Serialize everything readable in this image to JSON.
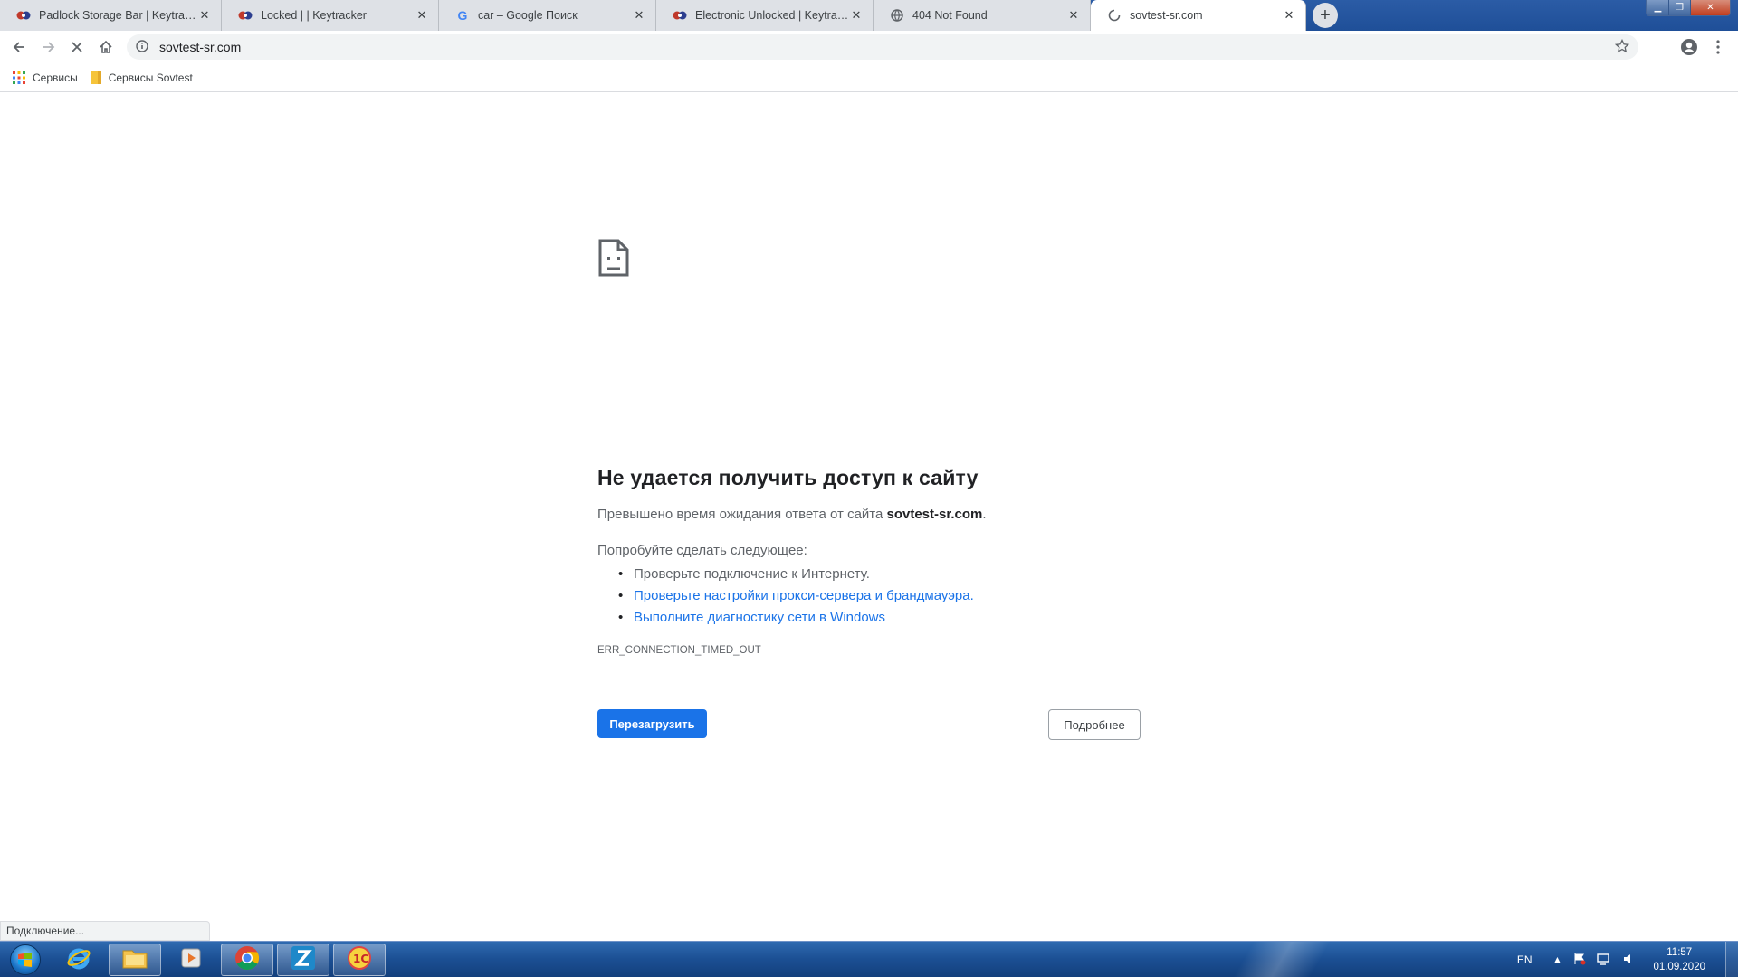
{
  "tabs": [
    {
      "title": "Padlock Storage Bar | Keytracker",
      "icon": "keytracker-favicon",
      "close": "✕"
    },
    {
      "title": "Locked | | Keytracker",
      "icon": "keytracker-favicon",
      "close": "✕"
    },
    {
      "title": "car – Google Поиск",
      "icon": "google-favicon",
      "close": "✕"
    },
    {
      "title": "Electronic Unlocked | Keytracker",
      "icon": "keytracker-favicon",
      "close": "✕"
    },
    {
      "title": "404 Not Found",
      "icon": "globe-favicon",
      "close": "✕"
    },
    {
      "title": "sovtest-sr.com",
      "icon": "loading-spinner",
      "close": "✕"
    }
  ],
  "new_tab": "+",
  "address": {
    "url": "sovtest-sr.com"
  },
  "bookmarks": [
    {
      "label": "Сервисы",
      "icon": "apps-grid-icon"
    },
    {
      "label": "Сервисы Sovtest",
      "icon": "folder-icon"
    }
  ],
  "error": {
    "title": "Не удается получить доступ к сайту",
    "message_prefix": "Превышено время ожидания ответа от сайта ",
    "site": "sovtest-sr.com",
    "message_suffix": ".",
    "try_label": "Попробуйте сделать следующее:",
    "suggestions": [
      "Проверьте подключение к Интернету.",
      "Проверьте настройки прокси-сервера и брандмауэра.",
      "Выполните диагностику сети в Windows"
    ],
    "code": "ERR_CONNECTION_TIMED_OUT",
    "reload_button": "Перезагрузить",
    "details_button": "Подробнее"
  },
  "status_text": "Подключение...",
  "taskbar": {
    "apps": [
      "windows-explorer-ie",
      "file-explorer",
      "media-player",
      "chrome",
      "z-app",
      "1c-app"
    ],
    "language": "EN",
    "time": "11:57",
    "date": "01.09.2020"
  },
  "colors": {
    "accent": "#1a73e8",
    "taskbar": "#1b4f93"
  }
}
